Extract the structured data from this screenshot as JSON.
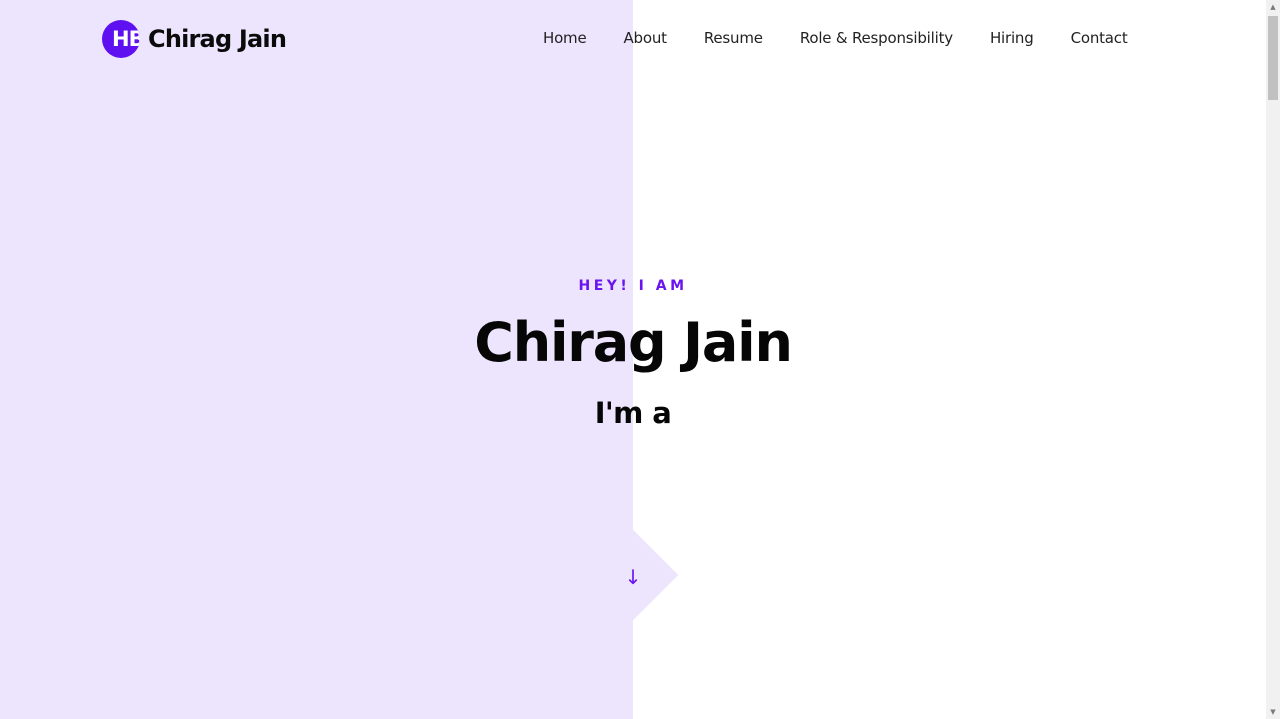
{
  "header": {
    "logo_badge": "HB",
    "logo_name": "Chirag Jain",
    "nav": [
      "Home",
      "About",
      "Resume",
      "Role & Responsibility",
      "Hiring",
      "Contact"
    ]
  },
  "hero": {
    "eyebrow": "HEY! I AM",
    "name": "Chirag Jain",
    "role_prefix": "I'm a"
  },
  "scroll_button": {
    "icon": "arrow-down-icon",
    "glyph": "↓"
  },
  "colors": {
    "accent": "#5e10f0",
    "panel": "#ede5fe",
    "text": "#060606"
  },
  "scrollbar": {
    "position_fraction": 0.0
  }
}
